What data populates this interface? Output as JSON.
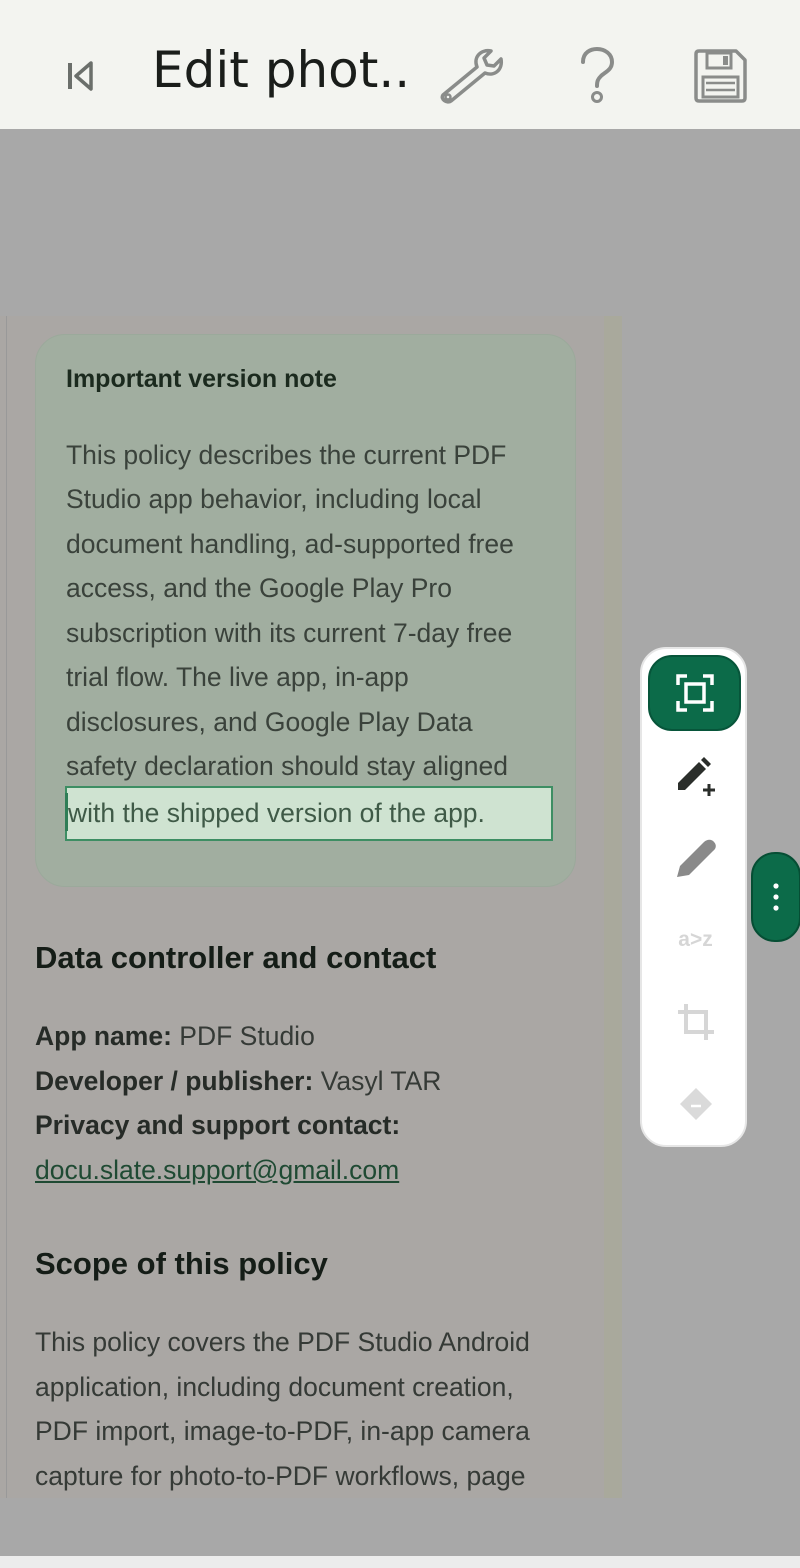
{
  "topbar": {
    "title": "Edit phot...",
    "icons": [
      "skip-back-icon",
      "wrench-icon",
      "help-icon",
      "save-icon"
    ]
  },
  "note": {
    "title": "Important version note",
    "lines": [
      "This policy describes the current PDF",
      "Studio app behavior, including local",
      "document handling, ad-supported free",
      "access, and the Google Play Pro",
      "subscription with its current 7-day free",
      "trial flow. The live app, in-app",
      "disclosures, and Google Play Data",
      "safety declaration should stay aligned",
      "with the shipped version of the app."
    ]
  },
  "contact": {
    "heading": "Data controller and contact",
    "app_name_label": "App name:",
    "app_name_value": " PDF Studio",
    "developer_label": "Developer / publisher:",
    "developer_value": " Vasyl TAR",
    "privacy_label": "Privacy and support contact:",
    "email": "docu.slate.support@gmail.com"
  },
  "scope": {
    "heading": "Scope of this policy",
    "lines": [
      "This policy covers the PDF Studio Android",
      "application, including document creation,",
      "PDF import, image-to-PDF, in-app camera",
      "capture for photo-to-PDF workflows, page"
    ]
  },
  "palette": {
    "tools": [
      "select-area-icon",
      "add-edit-icon",
      "pencil-icon",
      "text-replace-icon",
      "crop-icon",
      "eraser-icon"
    ],
    "text_replace_label": "a>z"
  },
  "colors": {
    "accent": "#0c6b49",
    "overlay": "#a8a8a8",
    "topbar": "#f3f4f0",
    "selection": "#cfe3d1"
  }
}
